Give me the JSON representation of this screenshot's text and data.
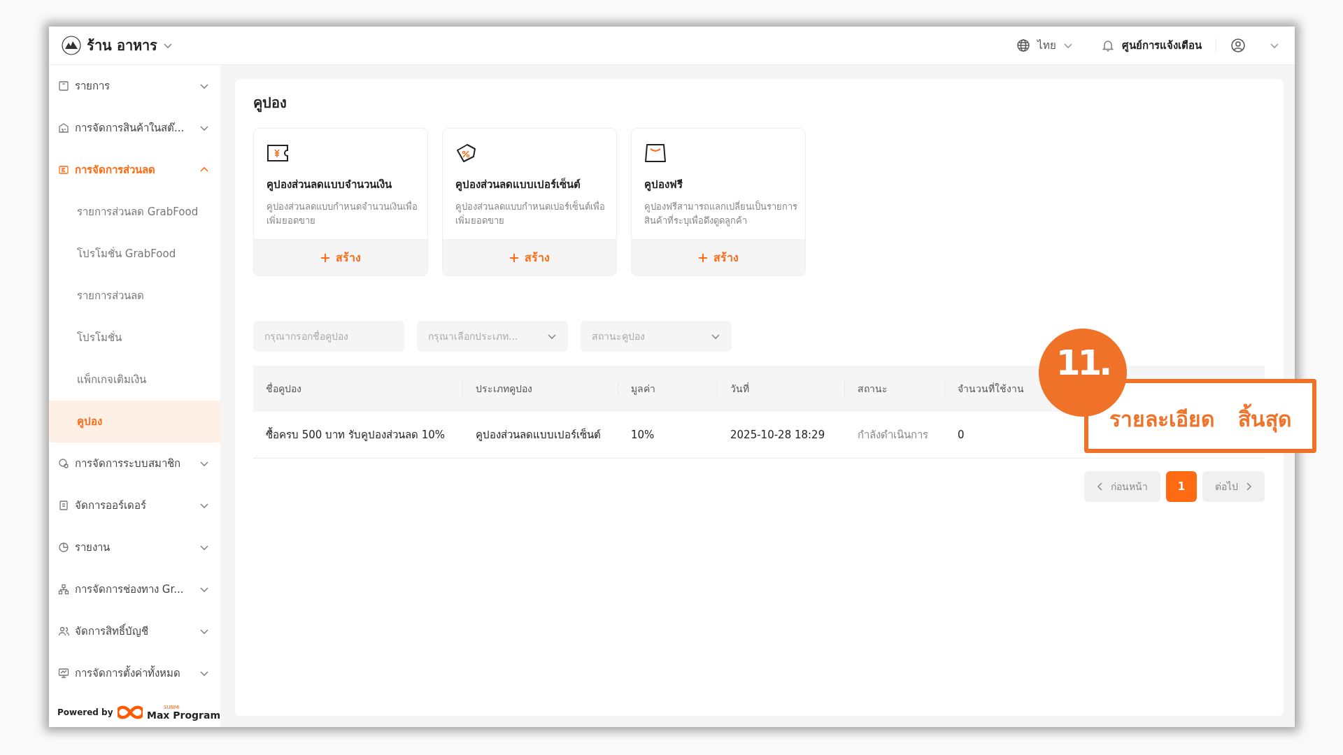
{
  "header": {
    "store_name": "ร้าน อาหาร",
    "language": "ไทย",
    "notifications": "ศูนย์การแจ้งเตือน"
  },
  "sidebar": {
    "items": [
      {
        "label": "รายการ",
        "expanded": false,
        "selected": false
      },
      {
        "label": "การจัดการสินค้าในสต๊...",
        "expanded": false,
        "selected": false
      },
      {
        "label": "การจัดการส่วนลด",
        "expanded": true,
        "selected": true,
        "children": [
          {
            "label": "รายการส่วนลด GrabFood",
            "selected": false
          },
          {
            "label": "โปรโมชั่น GrabFood",
            "selected": false
          },
          {
            "label": "รายการส่วนลด",
            "selected": false
          },
          {
            "label": "โปรโมชั่น",
            "selected": false
          },
          {
            "label": "แพ็กเกจเติมเงิน",
            "selected": false
          },
          {
            "label": "คูปอง",
            "selected": true
          }
        ]
      },
      {
        "label": "การจัดการระบบสมาชิก",
        "expanded": false,
        "selected": false
      },
      {
        "label": "จัดการออร์เดอร์",
        "expanded": false,
        "selected": false
      },
      {
        "label": "รายงาน",
        "expanded": false,
        "selected": false
      },
      {
        "label": "การจัดการช่องทาง Gr...",
        "expanded": false,
        "selected": false
      },
      {
        "label": "จัดการสิทธิ์บัญชี",
        "expanded": false,
        "selected": false
      },
      {
        "label": "การจัดการตั้งค่าทั้งหมด",
        "expanded": false,
        "selected": false
      }
    ],
    "powered_by": "Powered by",
    "brand_mark": "SUNMI",
    "brand": "Max Program"
  },
  "page": {
    "title": "คูปอง",
    "cards": [
      {
        "kind": "amount",
        "title": "คูปองส่วนลดแบบจำนวนเงิน",
        "description": "คูปองส่วนลดแบบกำหนดจำนวนเงินเพื่อเพิ่มยอดขาย",
        "action": "สร้าง"
      },
      {
        "kind": "percent",
        "title": "คูปองส่วนลดแบบเปอร์เซ็นต์",
        "description": "คูปองส่วนลดแบบกำหนดเปอร์เซ็นต์เพื่อเพิ่มยอดขาย",
        "action": "สร้าง"
      },
      {
        "kind": "free",
        "title": "คูปองฟรี",
        "description": "คูปองฟรีสามารถแลกเปลี่ยนเป็นรายการสินค้าที่ระบุเพื่อดึงดูดลูกค้า",
        "action": "สร้าง"
      }
    ],
    "filters": [
      {
        "kind": "input",
        "placeholder": "กรุณากรอกชื่อคูปอง"
      },
      {
        "kind": "select",
        "placeholder": "กรุณาเลือกประเภท..."
      },
      {
        "kind": "select",
        "placeholder": "สถานะคูปอง"
      }
    ],
    "table": {
      "columns": [
        "ชื่อคูปอง",
        "ประเภทคูปอง",
        "มูลค่า",
        "วันที่",
        "สถานะ",
        "จำนวนที่ใช้งาน"
      ],
      "rows": [
        [
          "ซื้อครบ 500 บาท รับคูปองส่วนลด 10%",
          "คูปองส่วนลดแบบเปอร์เซ็นต์",
          "10%",
          "2025-10-28 18:29",
          "กำลังดำเนินการ",
          "0"
        ]
      ]
    },
    "pagination": {
      "previous": {
        "label": "ก่อนหน้า",
        "disabled": true
      },
      "pages": [
        {
          "label": "1",
          "selected": true
        }
      ],
      "next": {
        "label": "ต่อไป",
        "disabled": true
      }
    }
  },
  "callout": {
    "step": "11.",
    "texts": [
      "รายละเอียด",
      "สิ้นสุด"
    ]
  }
}
